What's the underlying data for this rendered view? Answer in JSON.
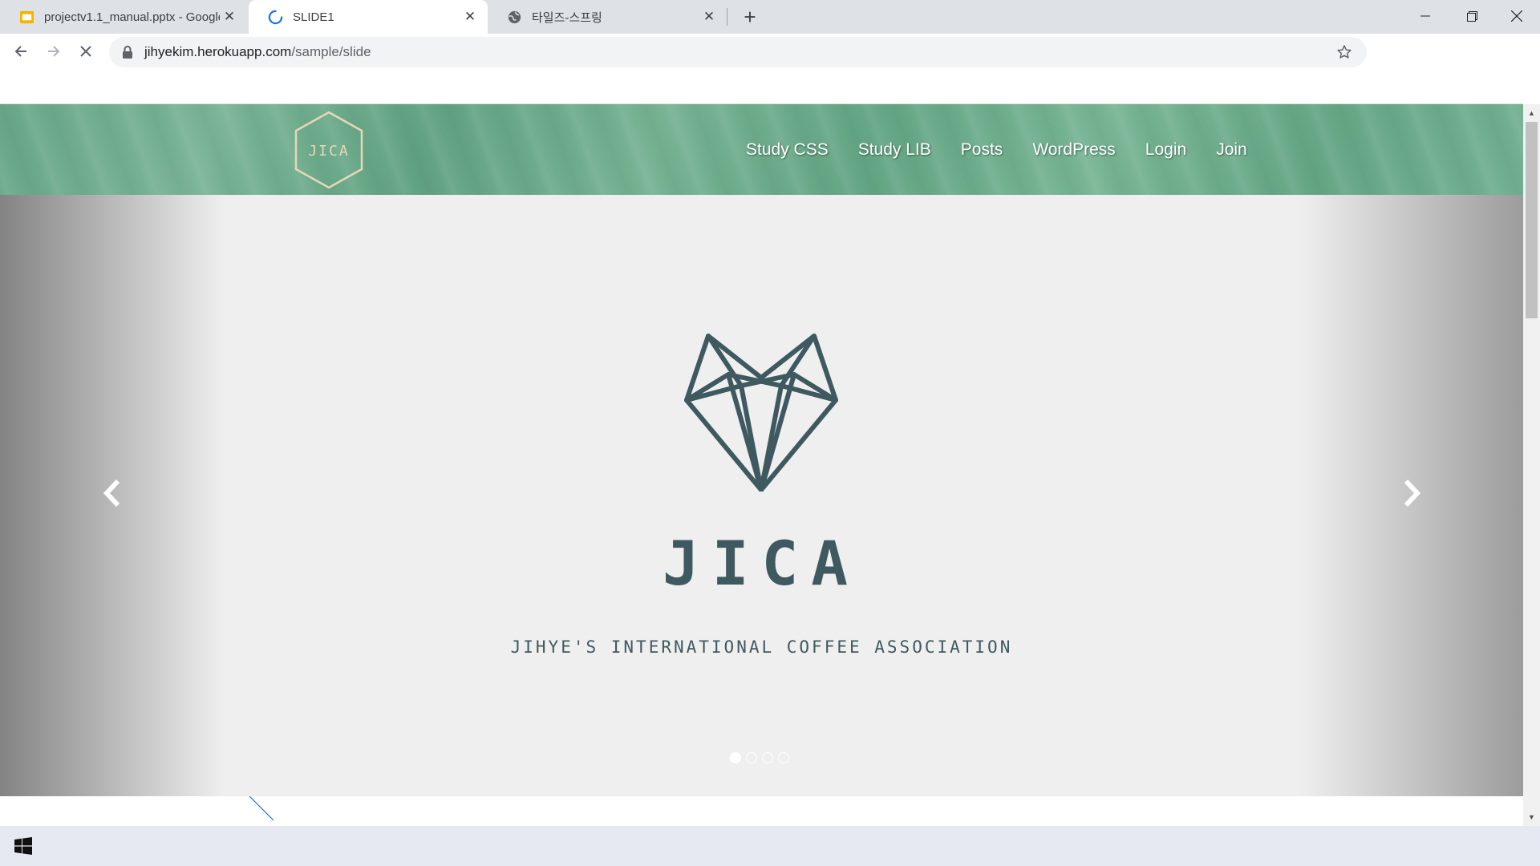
{
  "browser": {
    "tabs": [
      {
        "title": "projectv1.1_manual.pptx - Google",
        "favicon": "slides-icon"
      },
      {
        "title": "SLIDE1",
        "favicon": "loading-spinner-icon",
        "active": true
      },
      {
        "title": "타일즈-스프링",
        "favicon": "globe-icon"
      }
    ],
    "url_host": "jihyekim.herokuapp.com",
    "url_path": "/sample/slide"
  },
  "site": {
    "logo_text": "JICA",
    "nav": [
      "Study CSS",
      "Study LIB",
      "Posts",
      "WordPress",
      "Login",
      "Join"
    ]
  },
  "hero": {
    "brand": "JICA",
    "tagline": "JIHYE'S INTERNATIONAL COFFEE ASSOCIATION",
    "slide_count": 4,
    "active_slide": 1
  },
  "colors": {
    "header_green": "#6aa889",
    "brand_slate": "#3f5960",
    "logo_stroke": "#e6d8b8"
  }
}
